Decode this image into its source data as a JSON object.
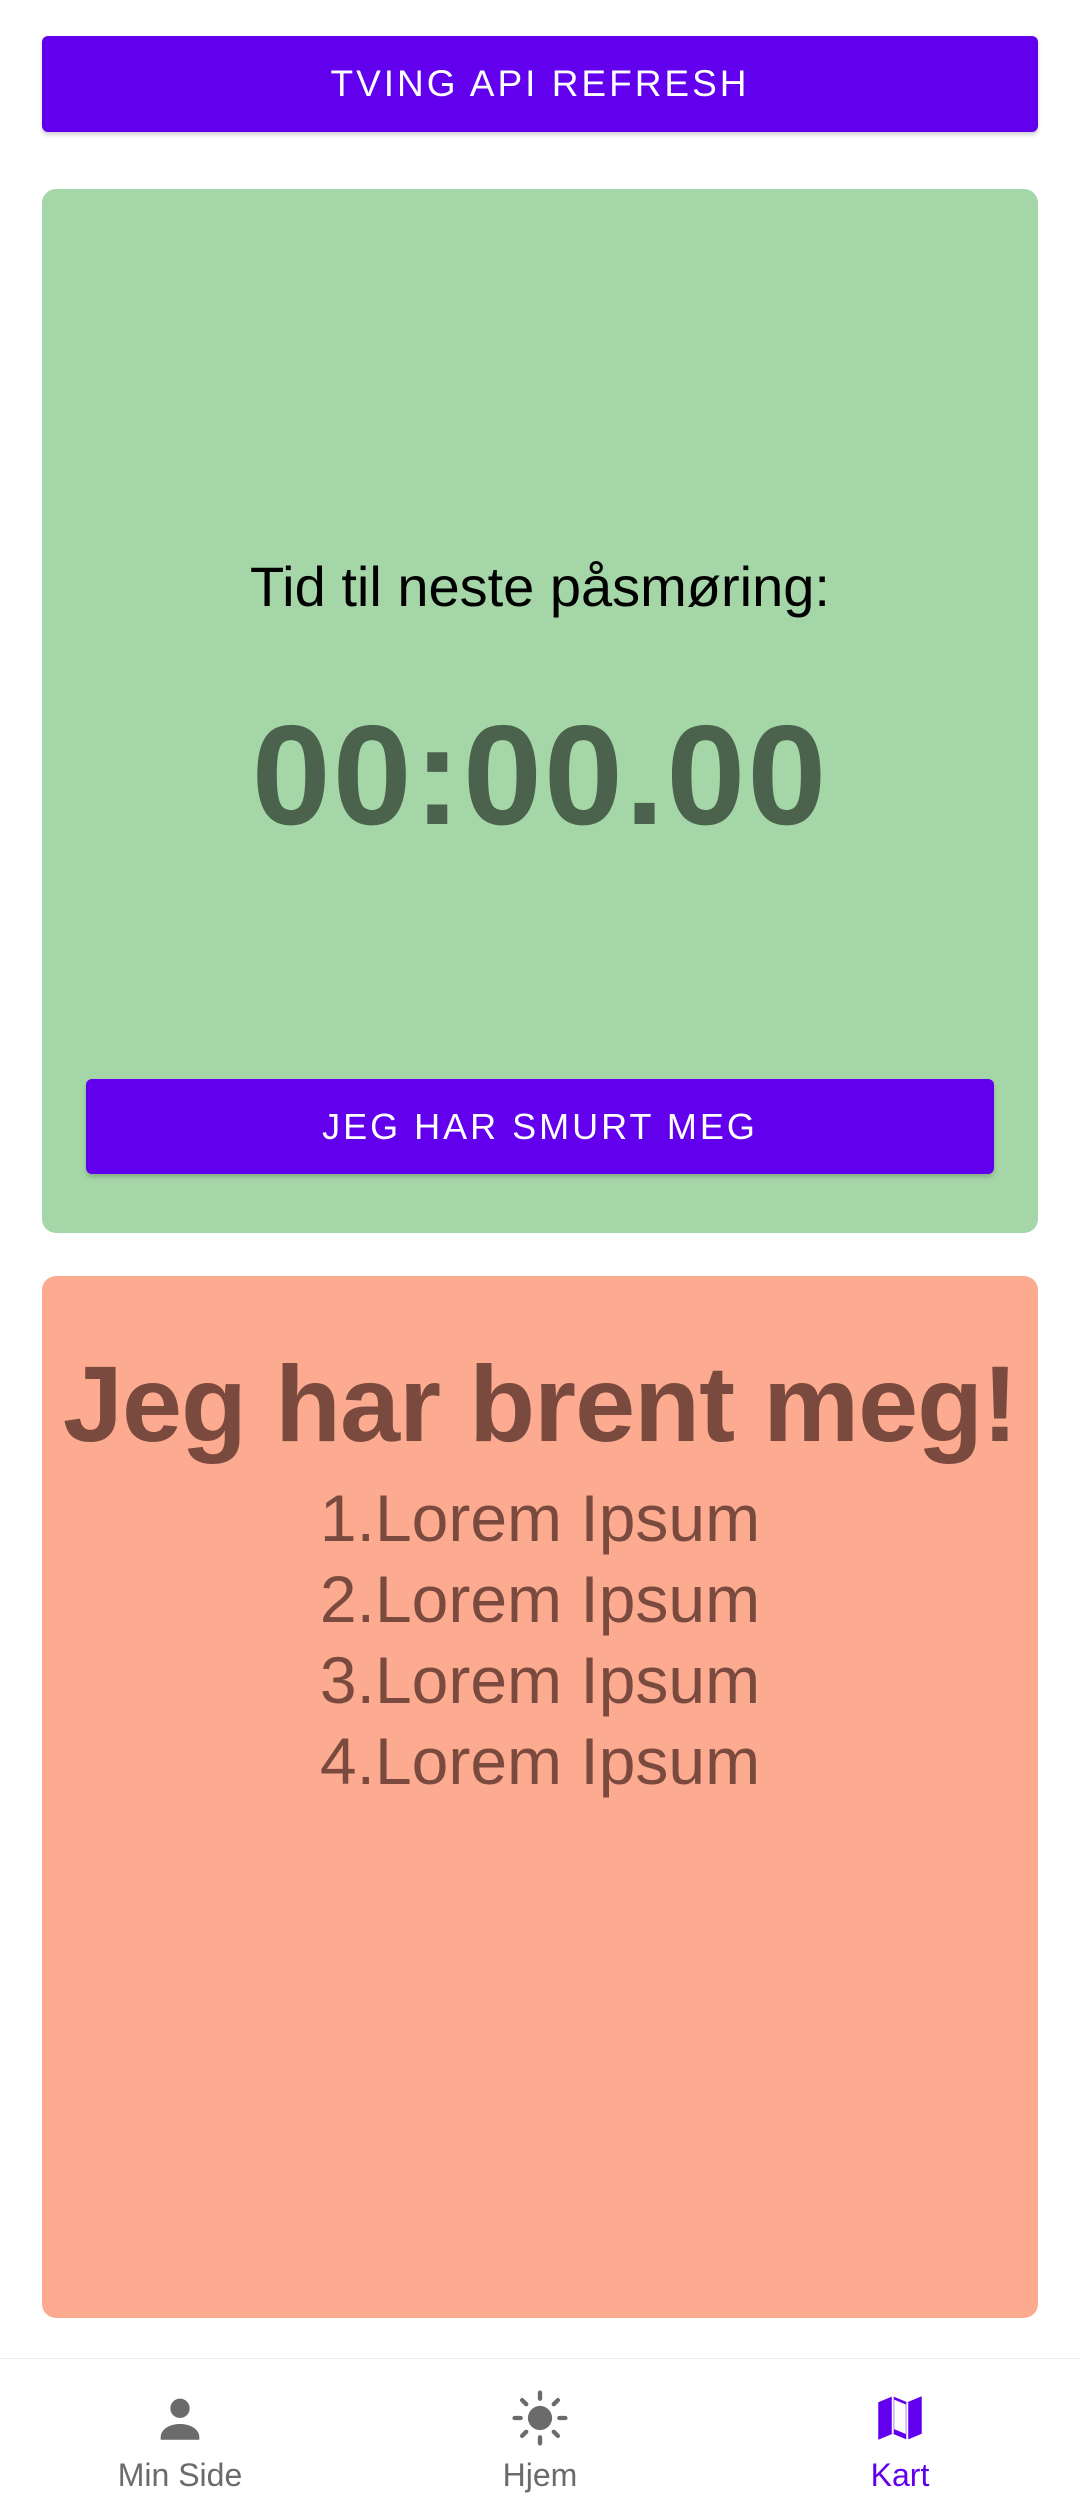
{
  "actions": {
    "refresh_label": "TVING API REFRESH"
  },
  "timer": {
    "label": "Tid til neste påsmøring:",
    "value": "00:00.00",
    "button_label": "JEG HAR SMURT MEG"
  },
  "burn": {
    "title": "Jeg har brent meg!",
    "items": [
      "1.Lorem Ipsum",
      "2.Lorem Ipsum",
      "3.Lorem Ipsum",
      "4.Lorem Ipsum"
    ]
  },
  "bottom_nav": {
    "items": [
      {
        "label": "Min Side",
        "icon": "person-icon",
        "active": false
      },
      {
        "label": "Hjem",
        "icon": "sun-icon",
        "active": false
      },
      {
        "label": "Kart",
        "icon": "map-icon",
        "active": true
      }
    ]
  },
  "colors": {
    "primary": "#6200ee",
    "timer_card_bg": "#a5d6a7",
    "timer_value": "#4b634c",
    "burn_card_bg": "#fcab90",
    "burn_text": "#7b4a3e",
    "nav_inactive": "#6b6b6b"
  }
}
